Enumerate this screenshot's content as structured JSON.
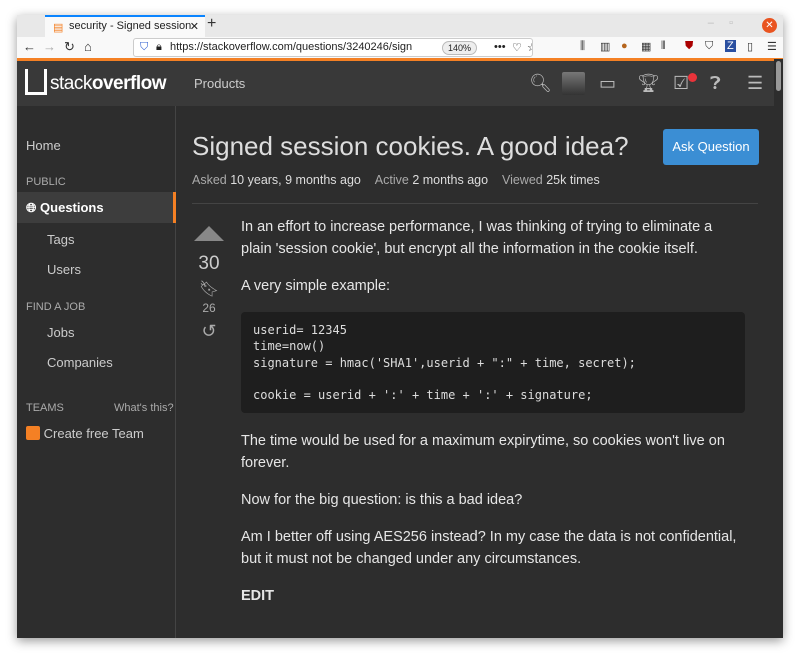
{
  "browser": {
    "tab_title": "security - Signed session",
    "url": "https://stackoverflow.com/questions/3240246/sign",
    "zoom": "140%"
  },
  "header": {
    "logo": {
      "plain": "stack",
      "bold": "overflow"
    },
    "products": "Products",
    "notification_badge_color": "#e9333a"
  },
  "sidebar": {
    "home": "Home",
    "public": "PUBLIC",
    "questions": "Questions",
    "tags": "Tags",
    "users": "Users",
    "find_a_job": "FIND A JOB",
    "jobs": "Jobs",
    "companies": "Companies",
    "teams": "TEAMS",
    "whats_this": "What's this?",
    "create_team": "Create free Team"
  },
  "question": {
    "title": "Signed session cookies. A good idea?",
    "ask_button": "Ask Question",
    "asked_label": "Asked",
    "asked": "10 years, 9 months ago",
    "active_label": "Active",
    "active": "2 months ago",
    "viewed_label": "Viewed",
    "viewed": "25k times",
    "votes": "30",
    "bookmarks": "26",
    "p1": "In an effort to increase performance, I was thinking of trying to eliminate a plain 'session cookie', but encrypt all the information in the cookie itself.",
    "p2": "A very simple example:",
    "code": "userid= 12345\ntime=now()\nsignature = hmac('SHA1',userid + \":\" + time, secret);\n\ncookie = userid + ':' + time + ':' + signature;",
    "p3": "The time would be used for a maximum expirytime, so cookies won't live on forever.",
    "p4": "Now for the big question: is this a bad idea?",
    "p5": "Am I better off using AES256 instead? In my case the data is not confidential, but it must not be changed under any circumstances.",
    "edit": "EDIT"
  },
  "colors": {
    "accent": "#f48024",
    "button": "#3b8ed4"
  }
}
